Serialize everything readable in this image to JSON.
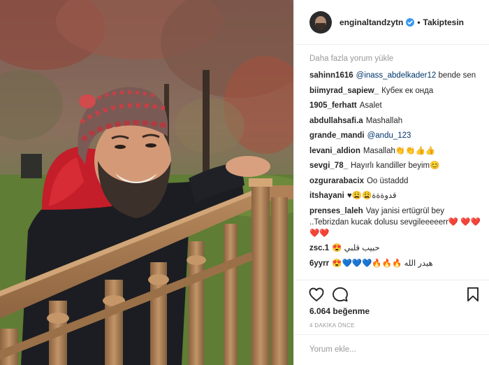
{
  "header": {
    "username": "enginaltandzytn",
    "verified_icon": "verified-badge-icon",
    "separator": "•",
    "follow_label": "Takiptesin"
  },
  "comments": {
    "load_more_label": "Daha fazla yorum yükle",
    "items": [
      {
        "author": "sahinn1616",
        "mention": "@inass_abdelkader12",
        "text": " bende sen"
      },
      {
        "author": "biimyrad_sapiew_",
        "mention": "",
        "text": "Кубек ек онда"
      },
      {
        "author": "1905_ferhatt",
        "mention": "",
        "text": "Asalet"
      },
      {
        "author": "abdullahsafi.a",
        "mention": "",
        "text": "Mashallah"
      },
      {
        "author": "grande_mandi",
        "mention": "@andu_123",
        "text": ""
      },
      {
        "author": "levani_aldion",
        "mention": "",
        "text": "Masallah👏👏👍👍"
      },
      {
        "author": "sevgi_78_",
        "mention": "",
        "text": "Hayırlı kandiller beyim😊"
      },
      {
        "author": "ozgurarabacix",
        "mention": "",
        "text": "Oo üstaddd"
      },
      {
        "author": "itshayani",
        "mention": "",
        "text": "قدوةةة😩😩♥"
      },
      {
        "author": "prenses_laleh",
        "mention": "",
        "text": "Vay janisi ertügrül bey ..Tebrizdan kucak dolusu sevgileeeeerr❤️ ❤️❤️❤️❤️"
      },
      {
        "author": "zsc.1",
        "mention": "",
        "text": "حبيب قلبي 😍"
      },
      {
        "author": "6yyrr",
        "mention": "",
        "text": "هيدر الله 🔥🔥🔥💙💙💙😍"
      }
    ]
  },
  "actions": {
    "like_icon": "heart-icon",
    "comment_icon": "comment-bubble-icon",
    "save_icon": "bookmark-icon"
  },
  "likes_label": "6.064 beğenme",
  "time_label": "4 DAKİKA ÖNCE",
  "add_comment": {
    "placeholder": "Yorum ekle..."
  },
  "colors": {
    "verified_blue": "#3897f0",
    "mention_blue": "#003569",
    "muted_grey": "#999999",
    "border": "#efefef"
  }
}
